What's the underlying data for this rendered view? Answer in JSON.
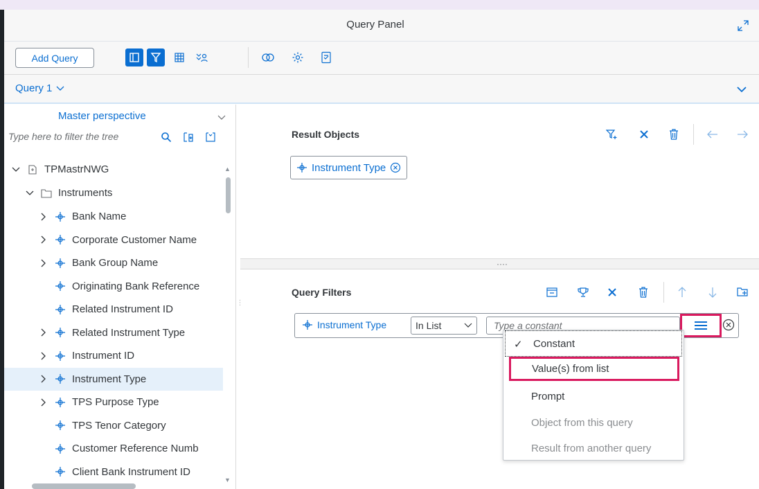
{
  "window": {
    "title": "Query Panel"
  },
  "toolbar": {
    "add_query_label": "Add Query",
    "icons": [
      "panel-icon",
      "filter-icon",
      "table-icon",
      "user-filter-icon",
      "combine-icon",
      "settings-icon",
      "sql-icon"
    ]
  },
  "query_tabs": {
    "active": "Query 1"
  },
  "tree": {
    "perspective": "Master perspective",
    "filter_placeholder": "Type here to filter the tree",
    "root": "TPMastrNWG",
    "folder": "Instruments",
    "items": [
      {
        "label": "Bank Name",
        "expandable": true
      },
      {
        "label": "Corporate Customer Name",
        "expandable": true
      },
      {
        "label": "Bank Group Name",
        "expandable": true
      },
      {
        "label": "Originating Bank Reference",
        "expandable": false
      },
      {
        "label": "Related Instrument ID",
        "expandable": false
      },
      {
        "label": "Related Instrument Type",
        "expandable": true
      },
      {
        "label": "Instrument ID",
        "expandable": true
      },
      {
        "label": "Instrument Type",
        "expandable": true,
        "selected": true
      },
      {
        "label": "TPS Purpose Type",
        "expandable": true
      },
      {
        "label": "TPS Tenor Category",
        "expandable": false
      },
      {
        "label": "Customer Reference Numb",
        "expandable": false
      },
      {
        "label": "Client Bank Instrument ID",
        "expandable": false
      }
    ]
  },
  "result_objects": {
    "title": "Result Objects",
    "chips": [
      "Instrument Type"
    ]
  },
  "query_filters": {
    "title": "Query Filters",
    "filter": {
      "object": "Instrument Type",
      "operator": "In List",
      "value_placeholder": "Type a constant"
    }
  },
  "value_menu": {
    "items": [
      {
        "label": "Constant",
        "checked": true,
        "disabled": false
      },
      {
        "label": "Value(s) from list",
        "checked": false,
        "disabled": false
      },
      {
        "label": "Prompt",
        "checked": false,
        "disabled": false
      },
      {
        "label": "Object from this query",
        "checked": false,
        "disabled": true
      },
      {
        "label": "Result from another query",
        "checked": false,
        "disabled": true
      }
    ]
  },
  "colors": {
    "accent": "#0a6ed1",
    "highlight": "#d9195e",
    "selected_row": "#e5f0fa"
  }
}
